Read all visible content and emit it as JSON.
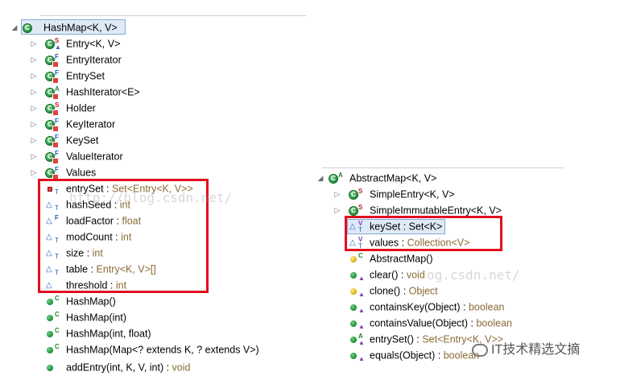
{
  "left_tree": {
    "root_label": "HashMap<K, V>",
    "inner_classes": [
      {
        "name": "Entry<K, V>"
      },
      {
        "name": "EntryIterator"
      },
      {
        "name": "EntrySet"
      },
      {
        "name": "HashIterator<E>"
      },
      {
        "name": "Holder"
      },
      {
        "name": "KeyIterator"
      },
      {
        "name": "KeySet"
      },
      {
        "name": "ValueIterator"
      },
      {
        "name": "Values"
      }
    ],
    "fields": [
      {
        "name": "entrySet",
        "type": "Set<Entry<K, V>>"
      },
      {
        "name": "hashSeed",
        "type": "int"
      },
      {
        "name": "loadFactor",
        "type": "float"
      },
      {
        "name": "modCount",
        "type": "int"
      },
      {
        "name": "size",
        "type": "int"
      },
      {
        "name": "table",
        "type": "Entry<K, V>[]"
      },
      {
        "name": "threshold",
        "type": "int"
      }
    ],
    "methods": [
      {
        "name": "HashMap()"
      },
      {
        "name": "HashMap(int)"
      },
      {
        "name": "HashMap(int, float)"
      },
      {
        "name": "HashMap(Map<? extends K, ? extends V>)"
      },
      {
        "name": "addEntry(int, K, V, int)",
        "type": "void"
      }
    ]
  },
  "right_tree": {
    "root_label": "AbstractMap<K, V>",
    "inner_classes": [
      {
        "name": "SimpleEntry<K, V>"
      },
      {
        "name": "SimpleImmutableEntry<K, V>"
      }
    ],
    "fields": [
      {
        "name": "keySet",
        "type": "Set<K>"
      },
      {
        "name": "values",
        "type": "Collection<V>"
      }
    ],
    "methods": [
      {
        "name": "AbstractMap()"
      },
      {
        "name": "clear()",
        "type": "void"
      },
      {
        "name": "clone()",
        "type": "Object"
      },
      {
        "name": "containsKey(Object)",
        "type": "boolean"
      },
      {
        "name": "containsValue(Object)",
        "type": "boolean"
      },
      {
        "name": "entrySet()",
        "type": "Set<Entry<K, V>>"
      },
      {
        "name": "equals(Object)",
        "type": "boolean"
      }
    ]
  },
  "watermarks": [
    "http://blog.csdn.net/",
    "og.csdn.net/"
  ],
  "logo_text": "IT技术精选文摘",
  "colors": {
    "highlight_box": "#e0101e",
    "type_text": "#8a6a36",
    "selection": "#dfeaf7",
    "class_icon": "#1f8f3a"
  }
}
